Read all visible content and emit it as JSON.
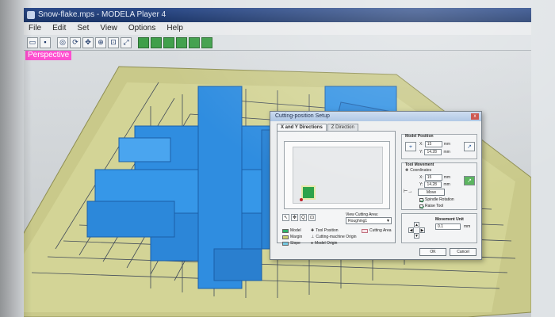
{
  "window": {
    "title": "Snow-flake.mps - MODELA Player 4"
  },
  "menu": [
    "File",
    "Edit",
    "Set",
    "View",
    "Options",
    "Help"
  ],
  "toolbar": {
    "icons": [
      "open-icon",
      "save-icon",
      "print-icon",
      "rotate-icon",
      "pan-icon",
      "zoom-icon",
      "zoom-window-icon",
      "zoom-fit-icon",
      "view-top-icon",
      "view-front-icon",
      "view-side-icon",
      "view-iso-icon",
      "view-back-icon",
      "view-bottom-icon"
    ]
  },
  "viewport": {
    "view_label": "Perspective"
  },
  "colors": {
    "model": "#2f8de0",
    "margin": "#cdd06e",
    "slope": "#74c8e0",
    "view_label_bg": "#ff4fd0"
  },
  "dialog": {
    "title": "Cutting-position Setup",
    "close": "x",
    "tabs": [
      "X and Y Directions",
      "Z Direction"
    ],
    "view_cutting_area": {
      "label": "View Cutting Area:",
      "value": "Roughing1"
    },
    "legend": {
      "model": "Model",
      "margin": "Margin",
      "slope": "Slope",
      "tool_position": "Tool Position",
      "cutting_machine_origin": "Cutting-machine Origin",
      "model_origin": "Model Origin",
      "cutting_area": "Cutting Area"
    },
    "model_position": {
      "title": "Model Position",
      "x": "15",
      "y": "14.28",
      "unit": "mm"
    },
    "tool_movement": {
      "title": "Tool Movement",
      "coordinates": "Coordinates",
      "x": "15",
      "y": "14.28",
      "unit": "mm",
      "move_label": "Move",
      "spindle_rotation": "Spindle Rotation",
      "raise_tool": "Raise Tool"
    },
    "movement_unit": {
      "title": "Movement Unit",
      "value": "0.1",
      "unit": "mm"
    },
    "ok": "OK",
    "cancel": "Cancel"
  }
}
